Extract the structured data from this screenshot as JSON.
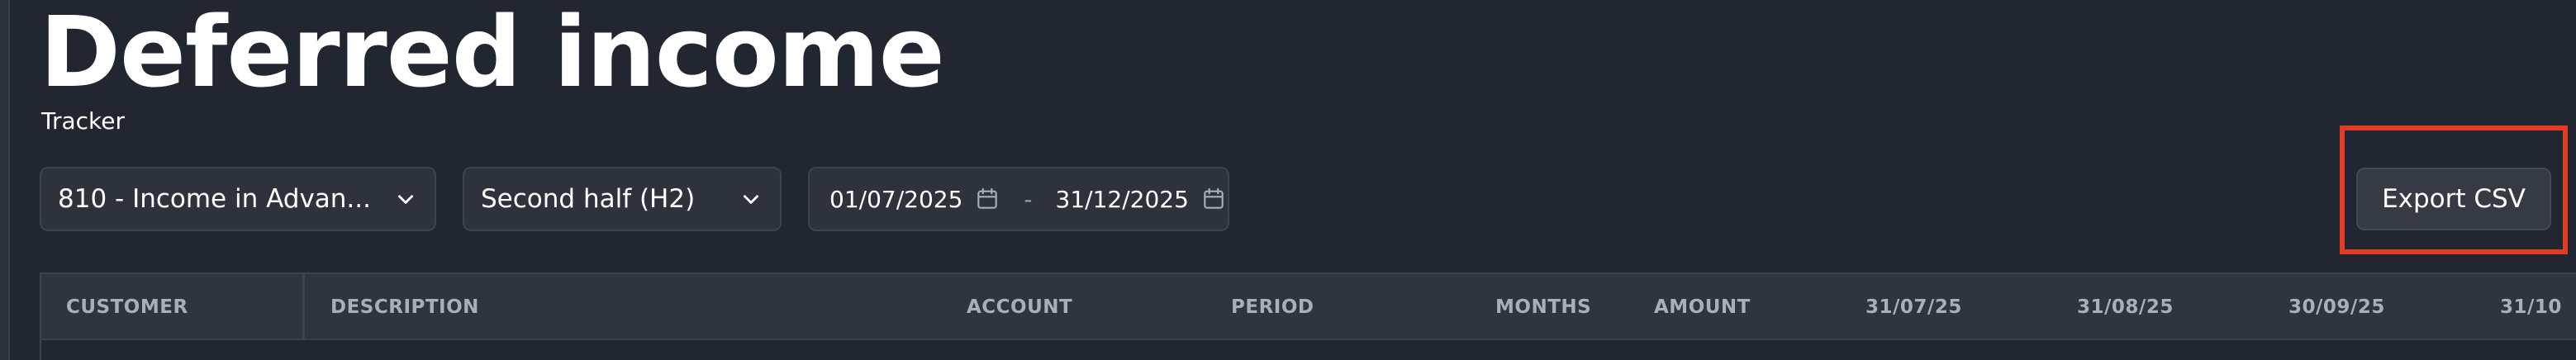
{
  "page": {
    "title": "Deferred income",
    "subtitle": "Tracker"
  },
  "filters": {
    "account_select": {
      "value": "810 - Income in Advan..."
    },
    "period_select": {
      "value": "Second half (H2)"
    },
    "date_range": {
      "start": "01/07/2025",
      "separator": "-",
      "end": "31/12/2025"
    }
  },
  "actions": {
    "export_label": "Export CSV"
  },
  "table": {
    "headers": [
      "CUSTOMER",
      "DESCRIPTION",
      "ACCOUNT",
      "PERIOD",
      "MONTHS",
      "AMOUNT",
      "31/07/25",
      "31/08/25",
      "30/09/25",
      "31/10"
    ]
  },
  "colors": {
    "background": "#222631",
    "highlight": "#e33b26"
  }
}
